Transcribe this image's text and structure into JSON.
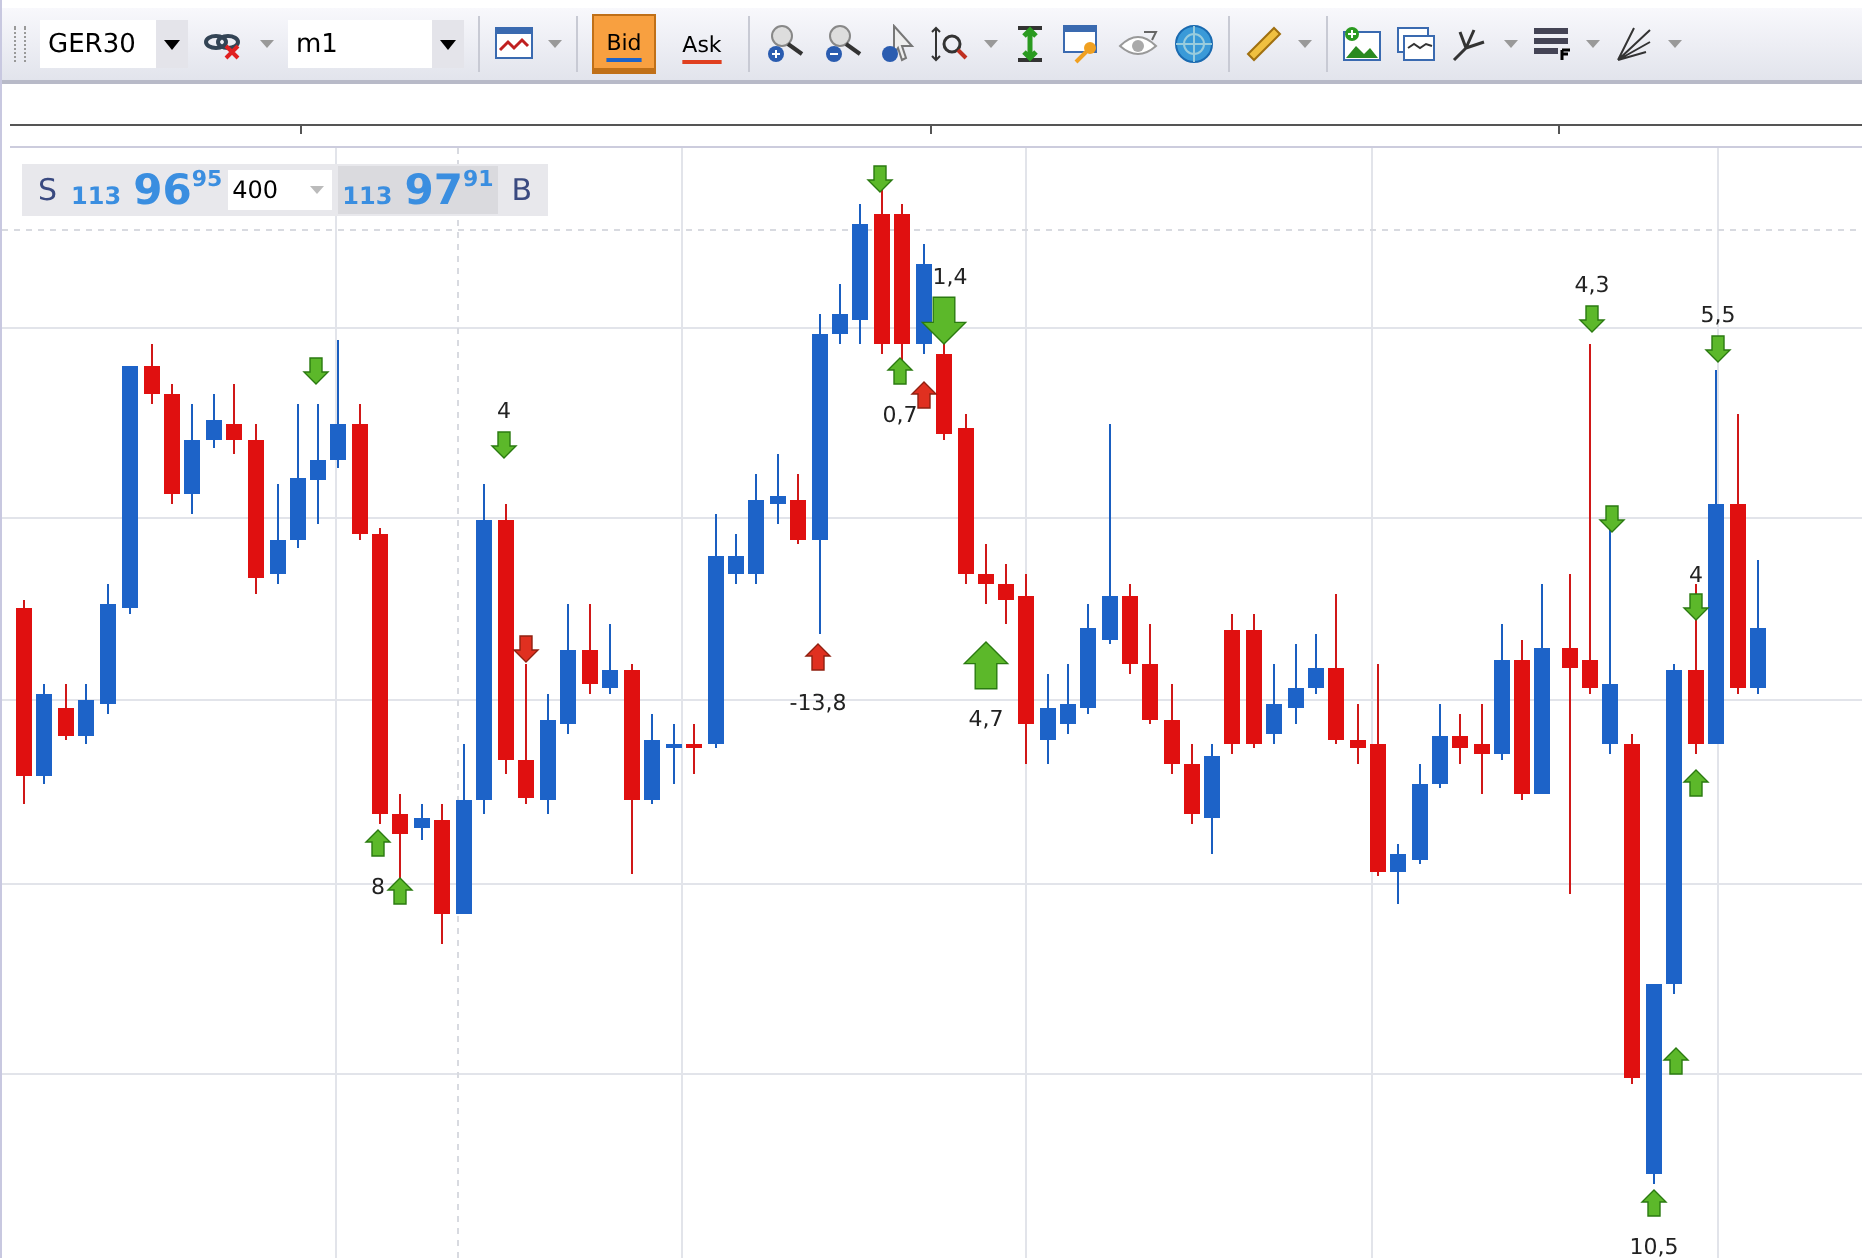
{
  "toolbar": {
    "symbol": "GER30",
    "timeframe": "m1",
    "price_buttons": [
      {
        "label": "Bid",
        "selected": true,
        "kind": "bid"
      },
      {
        "label": "Ask",
        "selected": false,
        "kind": "ask"
      }
    ]
  },
  "price_panel": {
    "sell_label": "S",
    "bid": {
      "prefix": "113",
      "big": "96",
      "pips": "95"
    },
    "amount": "400",
    "ask": {
      "prefix": "113",
      "big": "97",
      "pips": "91"
    },
    "buy_label": "B"
  },
  "chart": {
    "labels": [
      "4",
      "8",
      "-13,8",
      "1,4",
      "0,7",
      "4,7",
      "4,3",
      "5,5",
      "4",
      "10,5"
    ]
  }
}
